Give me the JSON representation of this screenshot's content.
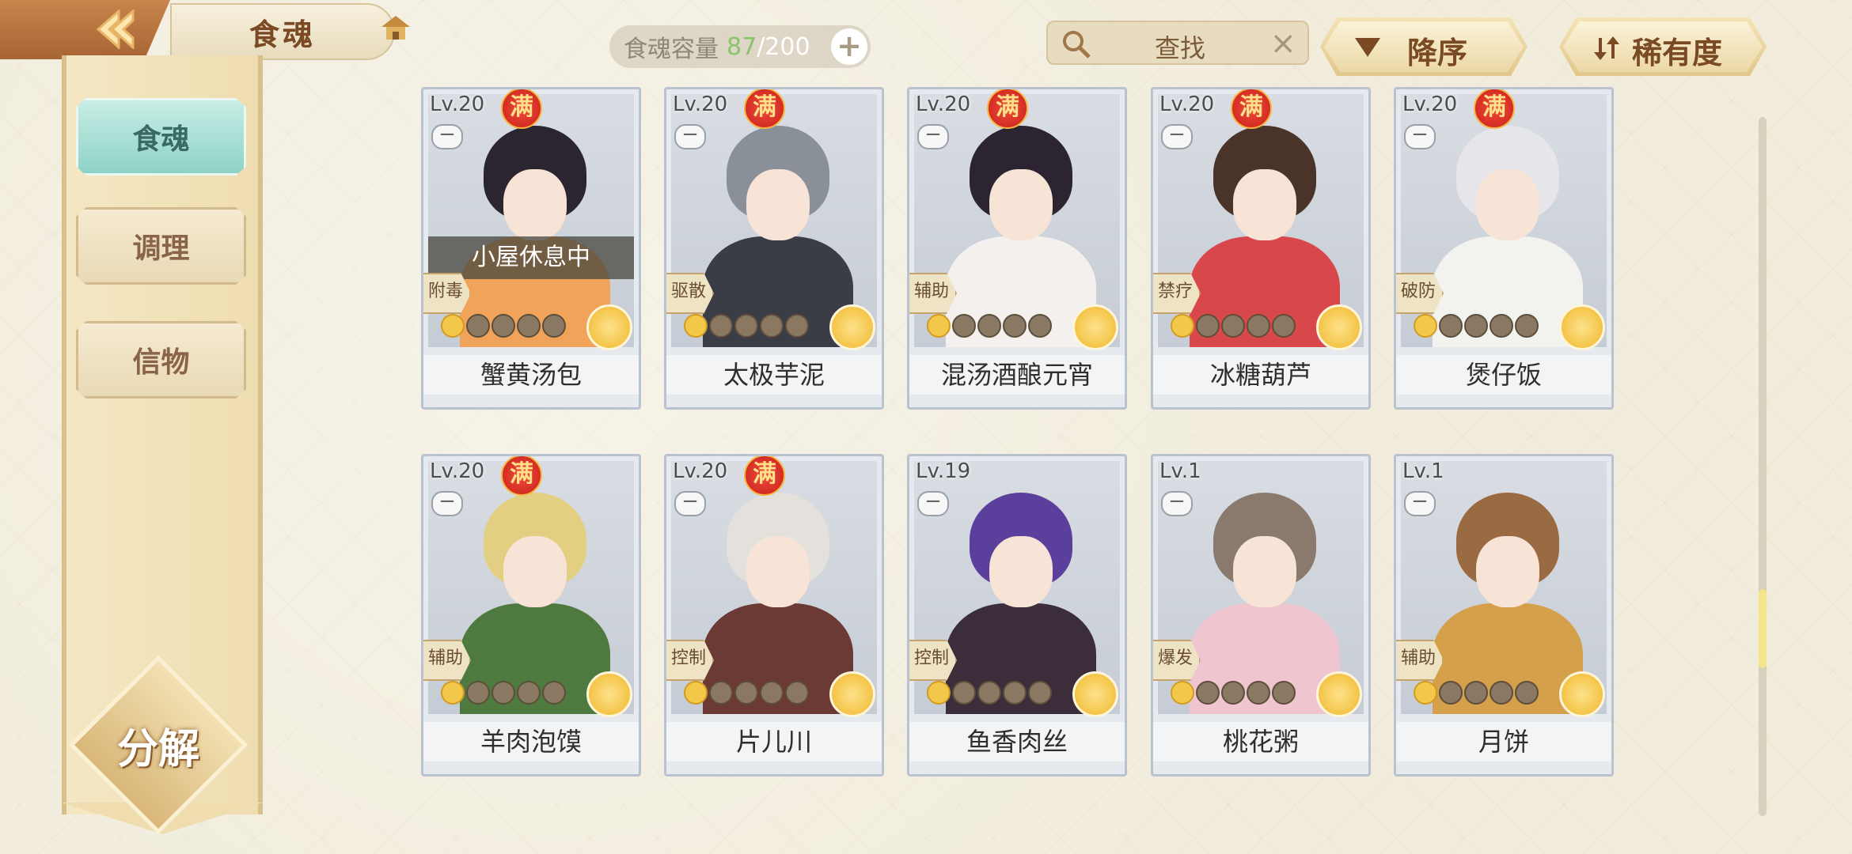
{
  "header": {
    "title": "食魂",
    "capacity_label": "食魂容量",
    "capacity_current": "87",
    "capacity_sep": "/",
    "capacity_max": "200",
    "search_placeholder": "查找",
    "sort_order_label": "降序",
    "sort_key_label": "稀有度"
  },
  "sidebar": {
    "tabs": [
      {
        "label": "食魂",
        "active": true
      },
      {
        "label": "调理",
        "active": false
      },
      {
        "label": "信物",
        "active": false
      }
    ],
    "decompose_label": "分解"
  },
  "cards": [
    {
      "level": "Lv.20",
      "full": "满",
      "role": "附毒",
      "name": "蟹黄汤包",
      "status": "小屋休息中",
      "stars": 1,
      "hair": "#2b2530",
      "outfit": "#f2a35a"
    },
    {
      "level": "Lv.20",
      "full": "满",
      "role": "驱散",
      "name": "太极芋泥",
      "status": "",
      "stars": 1,
      "hair": "#8a9098",
      "outfit": "#3a3d46"
    },
    {
      "level": "Lv.20",
      "full": "满",
      "role": "辅助",
      "name": "混汤酒酿元宵",
      "status": "",
      "stars": 1,
      "hair": "#2c2430",
      "outfit": "#f3f0ee"
    },
    {
      "level": "Lv.20",
      "full": "满",
      "role": "禁疗",
      "name": "冰糖葫芦",
      "status": "",
      "stars": 1,
      "hair": "#4a3328",
      "outfit": "#d8484a"
    },
    {
      "level": "Lv.20",
      "full": "满",
      "role": "破防",
      "name": "煲仔饭",
      "status": "",
      "stars": 1,
      "hair": "#e6e6ea",
      "outfit": "#f2f2ee"
    },
    {
      "level": "Lv.20",
      "full": "满",
      "role": "辅助",
      "name": "羊肉泡馍",
      "status": "",
      "stars": 1,
      "hair": "#e3cf82",
      "outfit": "#4f7a3f"
    },
    {
      "level": "Lv.20",
      "full": "满",
      "role": "控制",
      "name": "片儿川",
      "status": "",
      "stars": 1,
      "hair": "#e4e1dc",
      "outfit": "#6b3a34"
    },
    {
      "level": "Lv.19",
      "full": "",
      "role": "控制",
      "name": "鱼香肉丝",
      "status": "",
      "stars": 1,
      "hair": "#5b3f9c",
      "outfit": "#3b2e3a"
    },
    {
      "level": "Lv.1",
      "full": "",
      "role": "爆发",
      "name": "桃花粥",
      "status": "",
      "stars": 1,
      "hair": "#8a7a6e",
      "outfit": "#efc6cf"
    },
    {
      "level": "Lv.1",
      "full": "",
      "role": "辅助",
      "name": "月饼",
      "status": "",
      "stars": 1,
      "hair": "#9a6a42",
      "outfit": "#d5a04b"
    }
  ]
}
